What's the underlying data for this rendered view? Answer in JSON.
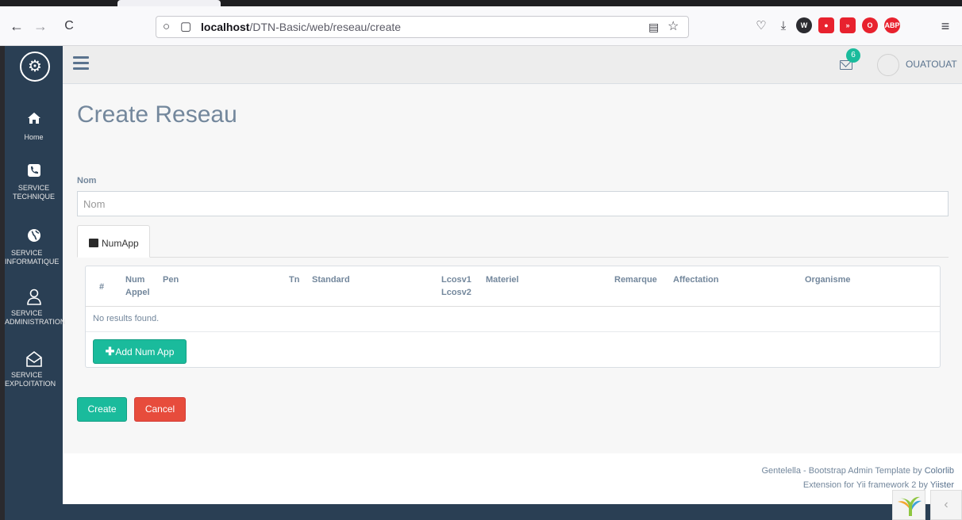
{
  "browser": {
    "url_host": "localhost",
    "url_path": "/DTN-Basic/web/reseau/create",
    "back_icon": "←",
    "forward_icon": "→",
    "reload_icon": "C",
    "menu_icon": "≡"
  },
  "sidebar": {
    "items": [
      {
        "label": "Home",
        "icon": "home-icon"
      },
      {
        "label_line1": "SERVICE",
        "label_line2": "TECHNIQUE",
        "icon": "phone-icon"
      },
      {
        "label_line1": "SERVICE",
        "label_line2": "INFORMATIQUE",
        "icon": "globe-icon"
      },
      {
        "label_line1": "SERVICE",
        "label_line2": "ADMINISTRATION",
        "icon": "user-icon"
      },
      {
        "label_line1": "SERVICE",
        "label_line2": "EXPLOITATION",
        "icon": "envelope-open-icon"
      }
    ]
  },
  "topnav": {
    "mail_count": "6",
    "username": "OUATOUAT"
  },
  "main": {
    "title": "Create Reseau",
    "nom_label": "Nom",
    "nom_placeholder": "Nom",
    "nom_value": "",
    "tab_label": "NumApp",
    "table": {
      "headers": {
        "index": "#",
        "num_appel_1": "Num",
        "num_appel_2": "Appel",
        "pen": "Pen",
        "tn": "Tn",
        "standard": "Standard",
        "lcosv_1": "Lcosv1",
        "lcosv_2": "Lcosv2",
        "materiel": "Materiel",
        "remarque": "Remarque",
        "affectation": "Affectation",
        "organisme": "Organisme"
      },
      "empty_text": "No results found."
    },
    "add_button": "Add Num App",
    "create_button": "Create",
    "cancel_button": "Cancel"
  },
  "footer": {
    "line1_prefix": "Gentelella - Bootstrap Admin Template by ",
    "line1_link": "Colorlib",
    "line2_prefix": "Extension for Yii framework 2 by ",
    "line2_link": "Yiister"
  },
  "colors": {
    "sidebar": "#2a3f54",
    "accent": "#1abb9c",
    "danger": "#e74c3c",
    "text": "#73879c"
  }
}
